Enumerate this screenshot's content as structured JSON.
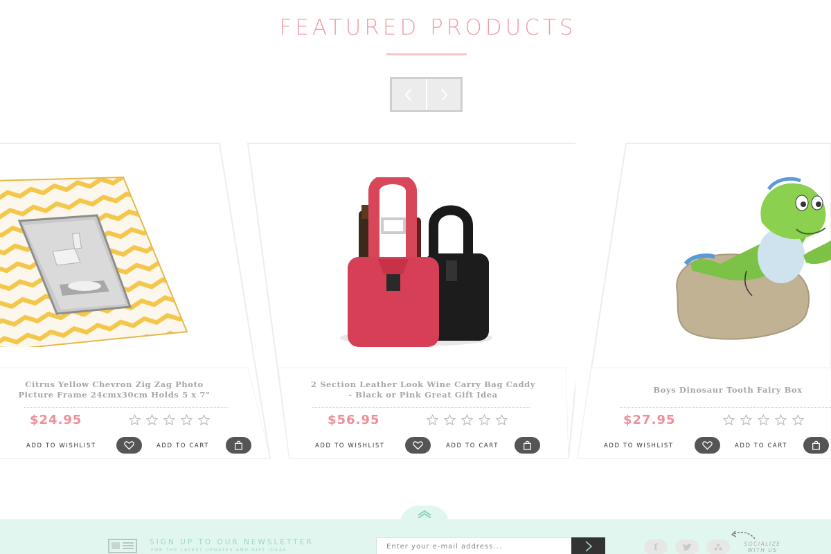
{
  "section": {
    "title": "FEATURED PRODUCTS"
  },
  "carousel": {
    "prev_icon": "chevron-left-icon",
    "next_icon": "chevron-right-icon"
  },
  "products": [
    {
      "name_line1": "Citrus Yellow Chevron Zig Zag Photo",
      "name_line2": "Picture Frame 24cmx30cm Holds 5 x 7\"",
      "price": "$24.95",
      "rating": 0,
      "rating_max": 5,
      "wishlist_label": "ADD TO WISHLIST",
      "cart_label": "ADD TO CART"
    },
    {
      "name_line1": "2 Section Leather Look Wine Carry Bag Caddy",
      "name_line2": "- Black or Pink Great Gift Idea",
      "price": "$56.95",
      "rating": 0,
      "rating_max": 5,
      "wishlist_label": "ADD TO WISHLIST",
      "cart_label": "ADD TO CART"
    },
    {
      "name_line1": "Boys Dinosaur Tooth Fairy Box",
      "name_line2": "",
      "price": "$27.95",
      "rating": 0,
      "rating_max": 5,
      "wishlist_label": "ADD TO WISHLIST",
      "cart_label": "ADD TO CART"
    }
  ],
  "footer": {
    "newsletter_title": "SIGN UP TO OUR NEWSLETTER",
    "newsletter_subtitle": "FOR THE LATEST UPDATES AND GIFT IDEAS",
    "email_placeholder": "Enter your e-mail address...",
    "socialize_line1": "SOCIALIZE",
    "socialize_line2": "WITH US",
    "social_icons": [
      "facebook-icon",
      "twitter-icon",
      "social-dots-icon"
    ],
    "colors": {
      "accent_pink": "#ef9ea6",
      "footer_mint": "#e1f6ef",
      "mint_text": "#9dd6c7"
    }
  }
}
